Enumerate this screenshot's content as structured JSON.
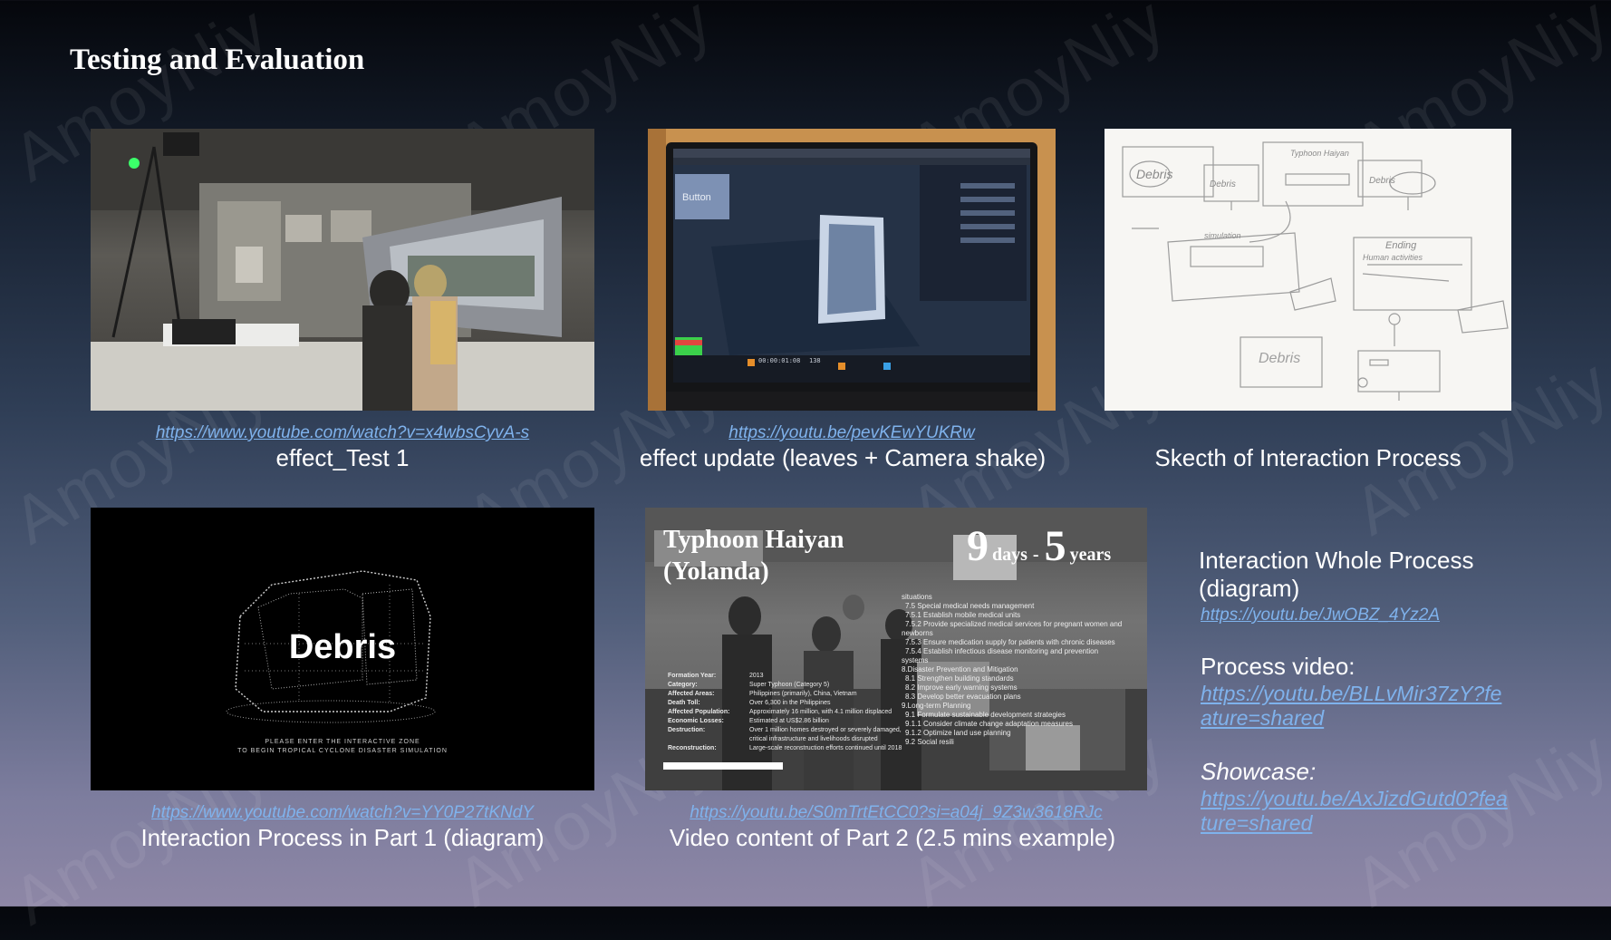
{
  "slide": {
    "title": "Testing and Evaluation",
    "watermark": "AmoyNiy"
  },
  "cards": [
    {
      "link": "https://www.youtube.com/watch?v=x4wbsCyvA-s",
      "caption": "effect_Test 1"
    },
    {
      "link": "https://youtu.be/pevKEwYUKRw ",
      "caption": "effect update (leaves + Camera shake)"
    },
    {
      "caption": "Skecth of Interaction Process"
    },
    {
      "link": "https://www.youtube.com/watch?v=YY0P27tKNdY",
      "caption": "Interaction Process in Part 1 (diagram)"
    },
    {
      "link": "https://youtu.be/S0mTrtEtCC0?si=a04j_9Z3w3618RJc",
      "caption": "Video content of Part 2 (2.5 mins example)"
    }
  ],
  "screen_ui": {
    "button_label": "Button",
    "timecode": "00:00:01:08",
    "frame": "138"
  },
  "debris": {
    "word": "Debris",
    "prompt_line1": "PLEASE ENTER THE INTERACTIVE ZONE",
    "prompt_line2": "TO BEGIN TROPICAL CYCLONE DISASTER SIMULATION"
  },
  "typhoon": {
    "title_line1": "Typhoon Haiyan",
    "title_line2": "(Yolanda)",
    "days_num": "9",
    "days_word": "days",
    "dash": "-",
    "years_num": "5",
    "years_word": "years",
    "info": [
      {
        "label": "Formation Year:",
        "value": "2013"
      },
      {
        "label": "Category:",
        "value": "Super Typhoon (Category 5)"
      },
      {
        "label": "Affected Areas:",
        "value": "Philippines (primarily), China, Vietnam"
      },
      {
        "label": "Death Toll:",
        "value": "Over 6,300 in the Philippines"
      },
      {
        "label": "Affected Population:",
        "value": "Approximately 16 million, with 4.1 million displaced"
      },
      {
        "label": "Economic Losses:",
        "value": "Estimated at US$2.86 billion"
      },
      {
        "label": "Destruction:",
        "value": "Over 1 million homes destroyed or severely damaged,"
      },
      {
        "label": "",
        "value": "critical infrastructure and livelihoods disrupted"
      },
      {
        "label": "Reconstruction:",
        "value": "Large-scale reconstruction efforts continued until 2018"
      }
    ],
    "plan": [
      "situations",
      "7.5 Special medical needs management",
      "7.5.1 Establish mobile medical units",
      "7.5.2 Provide specialized medical services for pregnant women and",
      "newborns",
      "7.5.3 Ensure medication supply for patients with chronic diseases",
      "7.5.4 Establish infectious disease monitoring and prevention",
      "systems",
      "8.Disaster Prevention and Mitigation",
      "8.1 Strengthen building standards",
      "8.2 Improve early warning systems",
      "8.3 Develop better evacuation plans",
      "9.Long-term Planning",
      "9.1 Formulate sustainable development strategies",
      "9.1.1 Consider climate change adaptation measures",
      "9.1.2 Optimize land use planning",
      "9.2 Social resili"
    ]
  },
  "sketch": {
    "notes": [
      "Debris",
      "Debris",
      "Typhoon Haiyan",
      "Debris",
      "simulation",
      "Ending",
      "Human activities",
      "Debris"
    ]
  },
  "sidebar": {
    "whole_label": " Interaction Whole Process (diagram)",
    "whole_link": "https://youtu.be/JwOBZ_4Yz2A",
    "process_label": "Process video:",
    "process_link": "https://youtu.be/BLLvMir37zY?feature=shared",
    "showcase_label": "Showcase:",
    "showcase_link": "https://youtu.be/AxJizdGutd0?feature=shared"
  }
}
